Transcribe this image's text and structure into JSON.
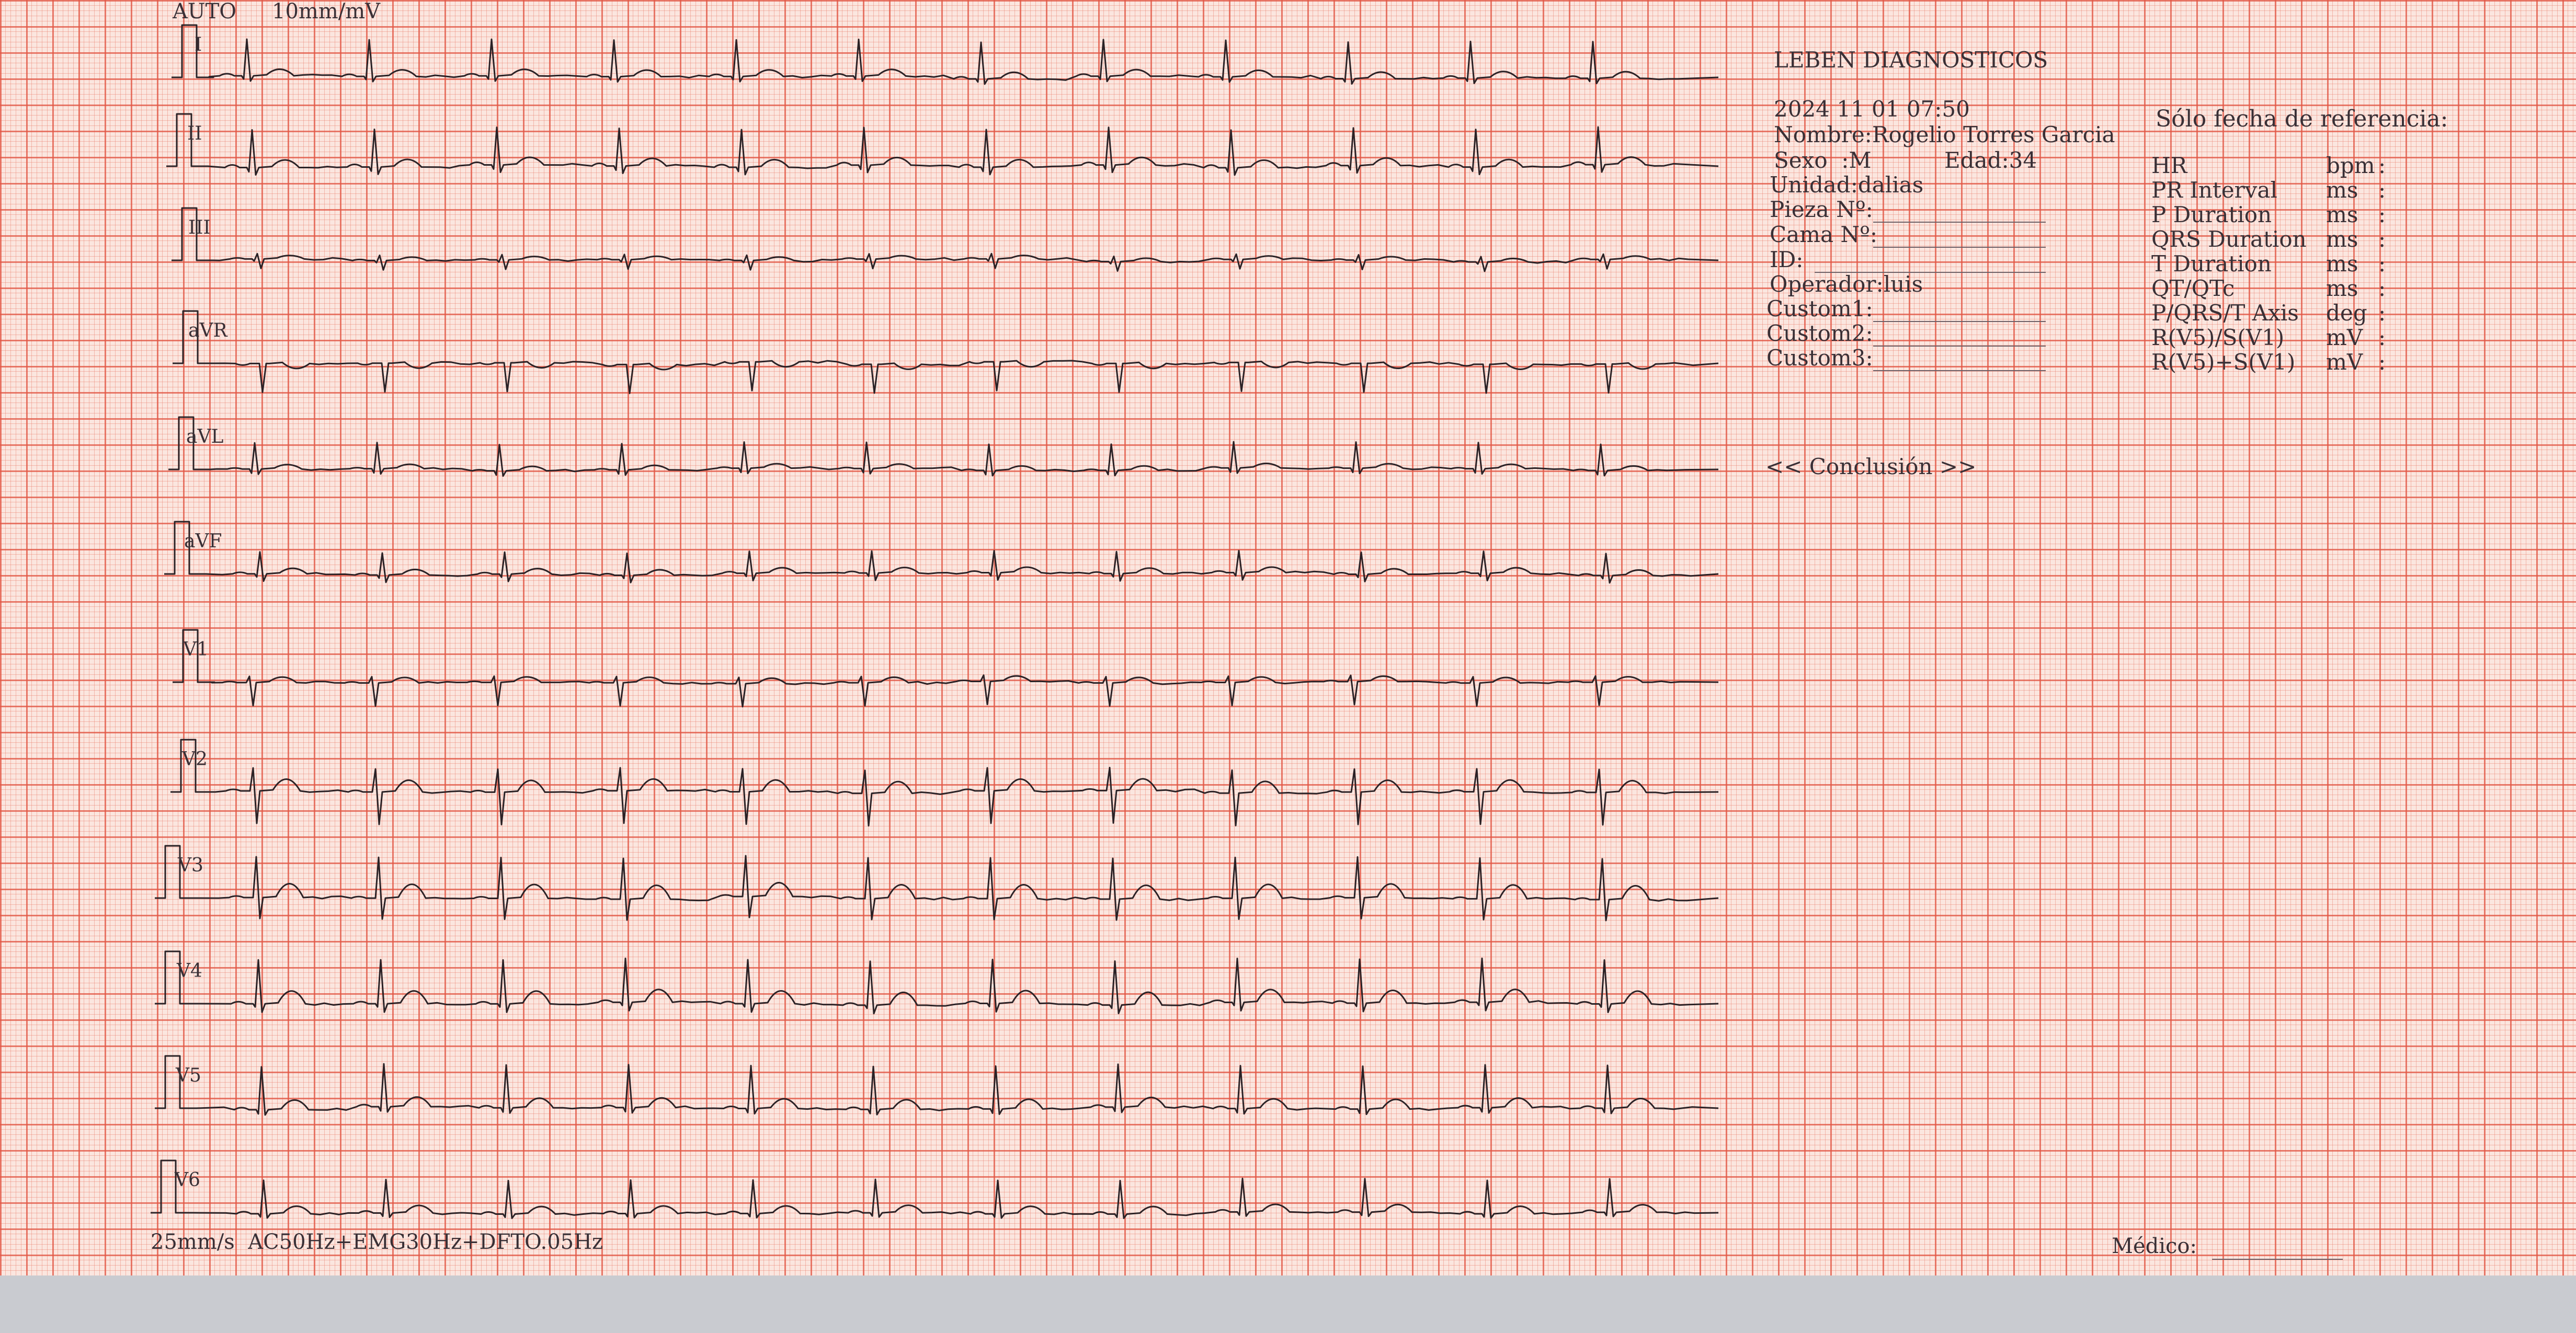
{
  "header": {
    "mode": "AUTO",
    "gain": "10mm/mV"
  },
  "leads": [
    "I",
    "II",
    "III",
    "aVR",
    "aVL",
    "aVF",
    "V1",
    "V2",
    "V3",
    "V4",
    "V5",
    "V6"
  ],
  "patient": {
    "clinic": "LEBEN DIAGNOSTICOS",
    "datetime": "2024 11 01 07:50",
    "name": "Nombre:Rogelio Torres Garcia",
    "sex": "Sexo  :M",
    "age": "Edad:34",
    "unit": "Unidad:dalias",
    "room": "Pieza Nº:",
    "bed": "Cama Nº:",
    "id": "ID:",
    "operator": "Operador:luis",
    "custom1": "Custom1:",
    "custom2": "Custom2:",
    "custom3": "Custom3:"
  },
  "measurements": {
    "reference_note": "Sólo fecha de referencia:",
    "rows": [
      {
        "label": "HR",
        "unit": "bpm",
        "sep": ":"
      },
      {
        "label": "PR Interval",
        "unit": "ms",
        "sep": ":"
      },
      {
        "label": "P Duration",
        "unit": "ms",
        "sep": ":"
      },
      {
        "label": "QRS Duration",
        "unit": "ms",
        "sep": ":"
      },
      {
        "label": "T Duration",
        "unit": "ms",
        "sep": ":"
      },
      {
        "label": "QT/QTc",
        "unit": "ms",
        "sep": ":"
      },
      {
        "label": "P/QRS/T Axis",
        "unit": "deg",
        "sep": ":"
      },
      {
        "label": "R(V5)/S(V1)",
        "unit": "mV",
        "sep": ":"
      },
      {
        "label": "R(V5)+S(V1)",
        "unit": "mV",
        "sep": ":"
      }
    ]
  },
  "conclusion_title": "<< Conclusión >>",
  "footer": {
    "settings": "25mm/s  AC50Hz+EMG30Hz+DFTO.05Hz",
    "doctor": "Médico:"
  },
  "colors": {
    "paper": "#fbe6df",
    "grid_major": "#e25644",
    "grid_minor": "#e87866",
    "trace": "#2b2226",
    "text": "#3a3036"
  }
}
